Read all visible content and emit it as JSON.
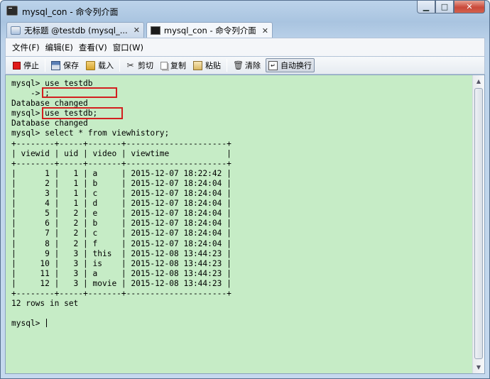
{
  "window": {
    "title": "mysql_con - 命令列介面",
    "minimize_glyph": "▁",
    "maximize_glyph": "□",
    "close_glyph": "✕"
  },
  "tabs": [
    {
      "label": "无标题 @testdb (mysql_...",
      "icon": "query-icon",
      "close": "✕"
    },
    {
      "label": "mysql_con - 命令列介面",
      "icon": "terminal-icon",
      "close": "✕"
    }
  ],
  "menu": [
    {
      "label": "文件(F)"
    },
    {
      "label": "编辑(E)"
    },
    {
      "label": "查看(V)"
    },
    {
      "label": "窗口(W)"
    }
  ],
  "toolbar": {
    "stop": "停止",
    "save": "保存",
    "load": "载入",
    "cut": "剪切",
    "copy": "复制",
    "paste": "粘贴",
    "clear": "清除",
    "autowrap": "自动换行"
  },
  "console": {
    "lines": [
      "mysql> use testdb",
      "    -> ;",
      "Database changed",
      "mysql> use testdb;",
      "Database changed",
      "mysql> select * from viewhistory;",
      "+--------+-----+-------+---------------------+",
      "| viewid | uid | video | viewtime            |",
      "+--------+-----+-------+---------------------+",
      "|      1 |   1 | a     | 2015-12-07 18:22:42 |",
      "|      2 |   1 | b     | 2015-12-07 18:24:04 |",
      "|      3 |   1 | c     | 2015-12-07 18:24:04 |",
      "|      4 |   1 | d     | 2015-12-07 18:24:04 |",
      "|      5 |   2 | e     | 2015-12-07 18:24:04 |",
      "|      6 |   2 | b     | 2015-12-07 18:24:04 |",
      "|      7 |   2 | c     | 2015-12-07 18:24:04 |",
      "|      8 |   2 | f     | 2015-12-07 18:24:04 |",
      "|      9 |   3 | this  | 2015-12-08 13:44:23 |",
      "|     10 |   3 | is    | 2015-12-08 13:44:23 |",
      "|     11 |   3 | a     | 2015-12-08 13:44:23 |",
      "|     12 |   3 | movie | 2015-12-08 13:44:23 |",
      "+--------+-----+-------+---------------------+",
      "12 rows in set",
      "",
      "mysql> "
    ],
    "background": "#c6ecc6",
    "highlight_color": "#d21f1f"
  }
}
